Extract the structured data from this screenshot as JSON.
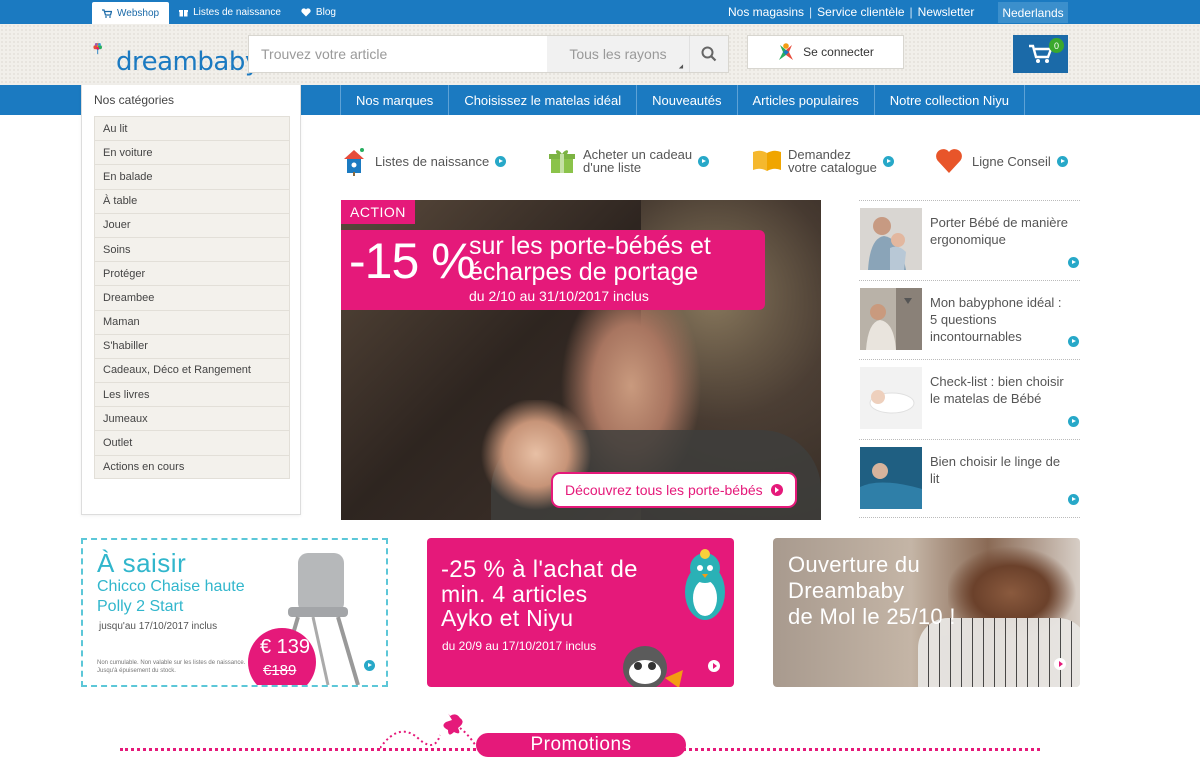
{
  "topbar": {
    "tabs": [
      {
        "label": "Webshop",
        "icon": "cart-icon"
      },
      {
        "label": "Listes de naissance",
        "icon": "gift-icon"
      },
      {
        "label": "Blog",
        "icon": "heart-icon"
      }
    ],
    "links": [
      "Nos magasins",
      "Service clientèle",
      "Newsletter"
    ],
    "language": "Nederlands"
  },
  "header": {
    "logo_text": "dreambaby",
    "search_placeholder": "Trouvez votre article",
    "search_category": "Tous les rayons",
    "login_label": "Se connecter",
    "cart_count": "0"
  },
  "nav": {
    "items": [
      "Nos marques",
      "Choisissez le matelas idéal",
      "Nouveautés",
      "Articles populaires",
      "Notre collection Niyu"
    ]
  },
  "categories": {
    "title": "Nos catégories",
    "items": [
      "Au lit",
      "En voiture",
      "En balade",
      "À table",
      "Jouer",
      "Soins",
      "Protéger",
      "Dreambee",
      "Maman",
      "S'habiller",
      "Cadeaux, Déco et Rangement",
      "Les livres",
      "Jumeaux",
      "Outlet",
      "Actions en cours"
    ]
  },
  "quick_links": [
    {
      "l1": "Listes de naissance",
      "l2": "",
      "icon": "birdhouse-icon"
    },
    {
      "l1": "Acheter un cadeau",
      "l2": "d'une liste",
      "icon": "gift-icon"
    },
    {
      "l1": "Demandez",
      "l2": "votre catalogue",
      "icon": "catalog-icon"
    },
    {
      "l1": "Ligne Conseil",
      "l2": "",
      "icon": "heart-icon"
    }
  ],
  "hero": {
    "tag": "ACTION",
    "percent": "-15 %",
    "line1": "sur les porte-bébés et",
    "line2": "écharpes de portage",
    "dates": "du 2/10 au 31/10/2017 inclus",
    "cta": "Découvrez tous les porte-bébés"
  },
  "articles": [
    {
      "title": "Porter Bébé de manière ergonomique"
    },
    {
      "title": "Mon babyphone idéal : 5 questions incontournables"
    },
    {
      "title": "Check-list : bien choisir le matelas de Bébé"
    },
    {
      "title": "Bien choisir le linge de lit"
    }
  ],
  "promo1": {
    "title": "À saisir",
    "line2": "Chicco Chaise haute",
    "line3": "Polly 2 Start",
    "until": "jusqu'au 17/10/2017 inclus",
    "note": "Non cumulable. Non valable sur les listes de naissance. Jusqu'à épuisement du stock.",
    "price_new": "€ 139",
    "price_old": "€189"
  },
  "promo2": {
    "line1": "-25 % à l'achat de",
    "line2": "min. 4 articles",
    "line3": "Ayko et Niyu",
    "dates": "du 20/9 au 17/10/2017 inclus"
  },
  "promo3": {
    "line1": "Ouverture du",
    "line2": "Dreambaby",
    "line3": "de Mol le 25/10 !"
  },
  "section": {
    "title": "Promotions"
  },
  "colors": {
    "brand_blue": "#1b7ac1",
    "brand_pink": "#e5197a",
    "accent_teal": "#31b6cc"
  }
}
